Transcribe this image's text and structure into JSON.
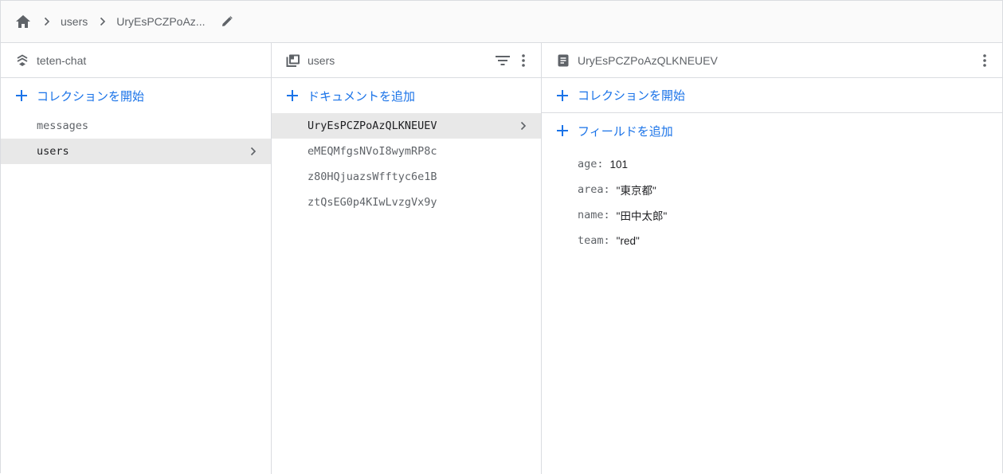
{
  "breadcrumb": {
    "items": [
      "users",
      "UryEsPCZPoAz..."
    ]
  },
  "colors": {
    "accent": "#1a73e8",
    "selected_bg": "#e8e8e8",
    "border": "#dadce0",
    "icon": "#5f6368"
  },
  "panel_root": {
    "title": "teten-chat",
    "add_label": "コレクションを開始",
    "items": [
      "messages",
      "users"
    ],
    "selected": "users"
  },
  "panel_collection": {
    "title": "users",
    "add_label": "ドキュメントを追加",
    "items": [
      "UryEsPCZPoAzQLKNEUEV",
      "eMEQMfgsNVoI8wymRP8c",
      "z80HQjuazsWfftyc6e1B",
      "ztQsEG0p4KIwLvzgVx9y"
    ],
    "selected": "UryEsPCZPoAzQLKNEUEV"
  },
  "panel_document": {
    "title": "UryEsPCZPoAzQLKNEUEV",
    "add_collection_label": "コレクションを開始",
    "add_field_label": "フィールドを追加",
    "fields": [
      {
        "key": "age",
        "value": "101"
      },
      {
        "key": "area",
        "value": "\"東京都\""
      },
      {
        "key": "name",
        "value": "\"田中太郎\""
      },
      {
        "key": "team",
        "value": "\"red\""
      }
    ]
  },
  "icons": {
    "home": "home-icon",
    "separator": "chevron-right-icon",
    "edit": "pencil-icon",
    "database": "database-stack-icon",
    "collection": "collection-icon",
    "document": "document-icon",
    "filter": "filter-icon",
    "more": "more-vert-icon",
    "add": "plus-icon"
  }
}
